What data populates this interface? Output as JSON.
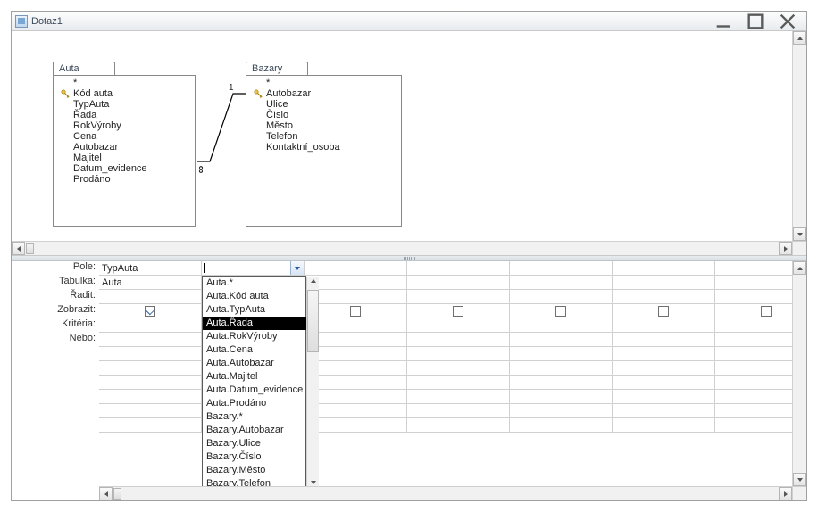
{
  "window": {
    "title": "Dotaz1"
  },
  "tables": {
    "auta": {
      "title": "Auta",
      "fields_key": "Kód auta",
      "fields": [
        "TypAuta",
        "Řada",
        "RokVýroby",
        "Cena",
        "Autobazar",
        "Majitel",
        "Datum_evidence",
        "Prodáno"
      ],
      "star": "*"
    },
    "bazary": {
      "title": "Bazary",
      "fields_key": "Autobazar",
      "fields": [
        "Ulice",
        "Číslo",
        "Město",
        "Telefon",
        "Kontaktní_osoba"
      ],
      "star": "*"
    }
  },
  "join": {
    "left": "1",
    "right": "∞"
  },
  "grid_labels": {
    "pole": "Pole:",
    "tabulka": "Tabulka:",
    "radit": "Řadit:",
    "zobrazit": "Zobrazit:",
    "kriteria": "Kritéria:",
    "nebo": "Nebo:"
  },
  "grid": {
    "col1": {
      "pole": "TypAuta",
      "tabulka": "Auta",
      "checked": true
    },
    "col2": {
      "pole": "",
      "tabulka": "",
      "checked": false
    },
    "col3": {
      "checked": false
    },
    "col4": {
      "checked": false
    },
    "col5": {
      "checked": false
    },
    "col6": {
      "checked": false
    },
    "col7": {
      "checked": false
    }
  },
  "dropdown": {
    "items": [
      "Auta.*",
      "Auta.Kód auta",
      "Auta.TypAuta",
      "Auta.Řada",
      "Auta.RokVýroby",
      "Auta.Cena",
      "Auta.Autobazar",
      "Auta.Majitel",
      "Auta.Datum_evidence",
      "Auta.Prodáno",
      "Bazary.*",
      "Bazary.Autobazar",
      "Bazary.Ulice",
      "Bazary.Číslo",
      "Bazary.Město",
      "Bazary.Telefon"
    ],
    "selected_index": 3
  }
}
